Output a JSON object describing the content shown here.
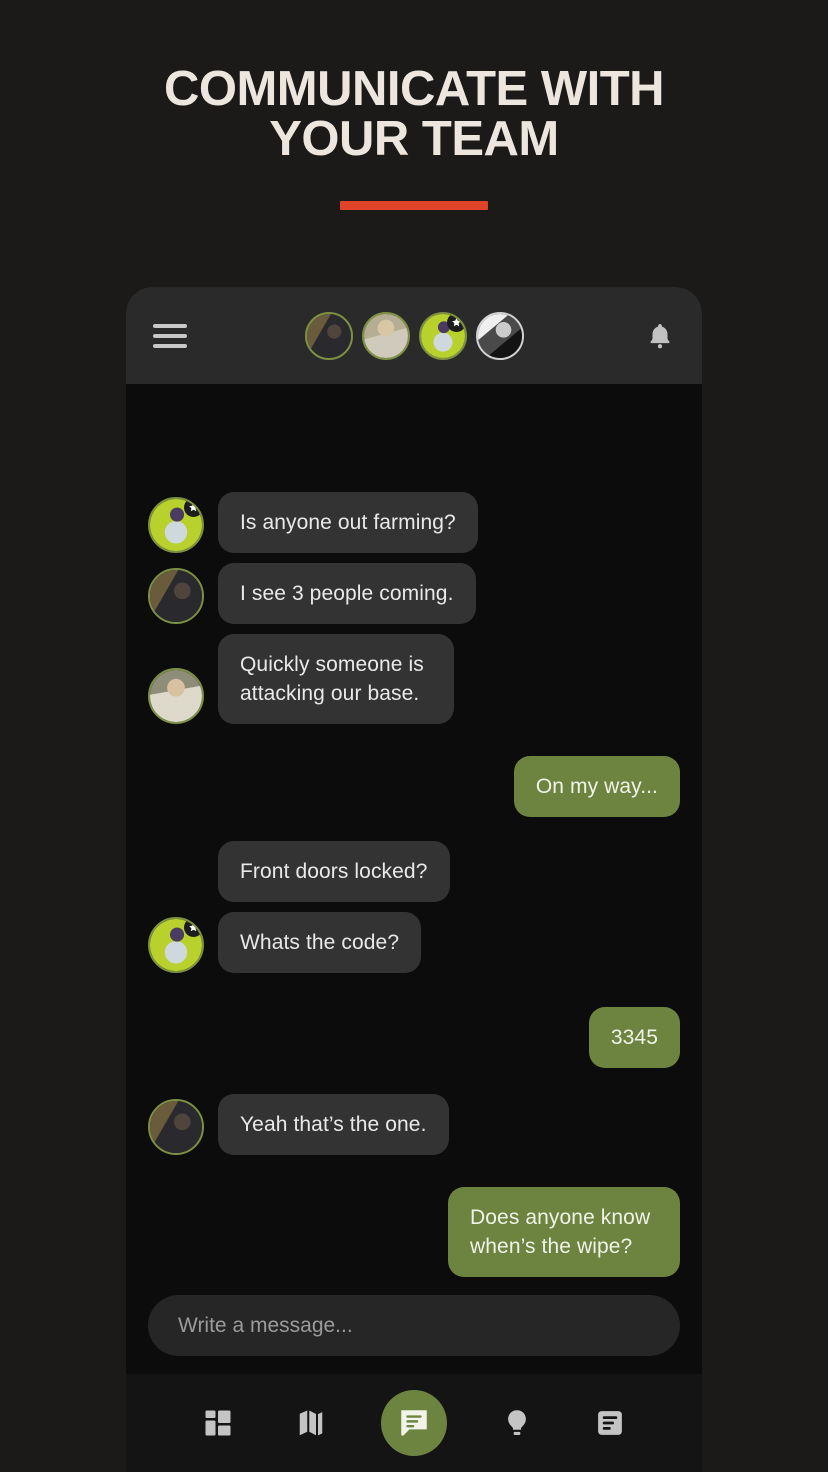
{
  "hero": {
    "title": "COMMUNICATE WITH YOUR TEAM",
    "accent_color": "#e04428"
  },
  "app": {
    "header": {
      "menu_icon": "hamburger-menu-icon",
      "notification_icon": "bell-icon",
      "avatars": [
        {
          "name": "member-1",
          "ring": "green",
          "badge": ""
        },
        {
          "name": "member-2",
          "ring": "green",
          "badge": ""
        },
        {
          "name": "member-3",
          "ring": "green",
          "badge": "star"
        },
        {
          "name": "member-4",
          "ring": "grey",
          "badge": ""
        }
      ]
    },
    "messages": [
      {
        "id": "m1",
        "side": "in",
        "text": "Is anyone out farming?",
        "avatar": "member-3",
        "show_avatar": true,
        "badge": "star"
      },
      {
        "id": "m2",
        "side": "in",
        "text": "I see 3 people coming.",
        "avatar": "member-1",
        "show_avatar": true,
        "badge": ""
      },
      {
        "id": "m3",
        "side": "in",
        "text": "Quickly someone is attacking our base.",
        "avatar": "member-5",
        "show_avatar": true,
        "badge": ""
      },
      {
        "id": "m4",
        "side": "out",
        "text": "On my way...",
        "avatar": "",
        "show_avatar": false,
        "badge": ""
      },
      {
        "id": "m5",
        "side": "in",
        "text": "Front doors locked?",
        "avatar": "",
        "show_avatar": false,
        "badge": ""
      },
      {
        "id": "m6",
        "side": "in",
        "text": "Whats the code?",
        "avatar": "member-3",
        "show_avatar": true,
        "badge": "star"
      },
      {
        "id": "m7",
        "side": "out",
        "text": "3345",
        "avatar": "",
        "show_avatar": false,
        "badge": ""
      },
      {
        "id": "m8",
        "side": "in",
        "text": "Yeah that’s the one.",
        "avatar": "member-1",
        "show_avatar": true,
        "badge": ""
      },
      {
        "id": "m9",
        "side": "out",
        "text": "Does anyone know when’s the wipe?",
        "avatar": "",
        "show_avatar": false,
        "badge": ""
      }
    ],
    "composer": {
      "placeholder": "Write a message...",
      "value": ""
    },
    "bottom_nav": {
      "items": [
        {
          "name": "dashboard",
          "icon": "dashboard-grid-icon",
          "active": false
        },
        {
          "name": "map",
          "icon": "map-icon",
          "active": false
        },
        {
          "name": "chat",
          "icon": "chat-bubble-icon",
          "active": true
        },
        {
          "name": "tips",
          "icon": "lightbulb-icon",
          "active": false
        },
        {
          "name": "news",
          "icon": "article-icon",
          "active": false
        }
      ],
      "active_color": "#6d8441"
    }
  },
  "colors": {
    "page_background": "#1b1a19",
    "phone_background": "#0c0c0c",
    "appbar_background": "#2a2a2a",
    "bubble_in": "#333333",
    "bubble_out": "#6d8441",
    "accent": "#e04428"
  }
}
